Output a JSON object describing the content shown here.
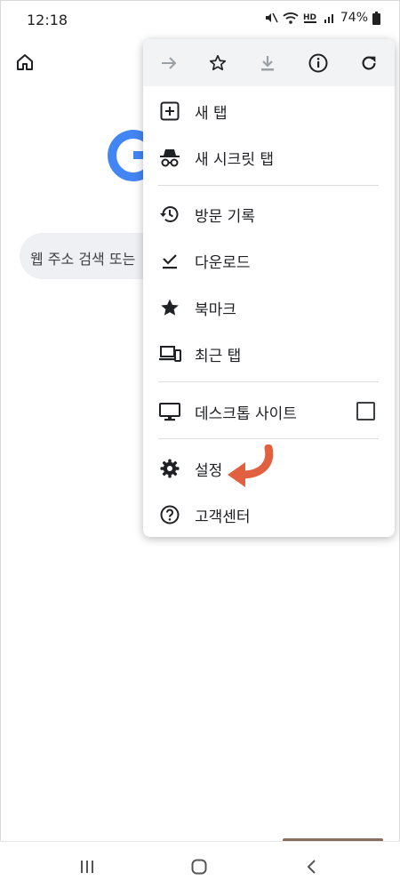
{
  "status_bar": {
    "time": "12:18",
    "battery": "74%",
    "icons": [
      "mute-icon",
      "wifi-icon",
      "hd-icon",
      "signal-icon",
      "battery-icon"
    ]
  },
  "page": {
    "search_placeholder": "웹 주소 검색 또는"
  },
  "menu": {
    "toolbar_icons": [
      "forward-icon",
      "bookmark-star-icon",
      "download-icon",
      "info-icon",
      "reload-icon"
    ],
    "items": [
      {
        "label": "새 탭",
        "icon": "new-tab-icon"
      },
      {
        "label": "새 시크릿 탭",
        "icon": "incognito-icon"
      },
      {
        "label": "방문 기록",
        "icon": "history-icon"
      },
      {
        "label": "다운로드",
        "icon": "downloads-icon"
      },
      {
        "label": "북마크",
        "icon": "bookmarks-icon"
      },
      {
        "label": "최근 탭",
        "icon": "recent-tabs-icon"
      },
      {
        "label": "데스크톱 사이트",
        "icon": "desktop-icon",
        "checked": false
      },
      {
        "label": "설정",
        "icon": "settings-icon"
      },
      {
        "label": "고객센터",
        "icon": "help-icon"
      }
    ]
  },
  "colors": {
    "annotation_arrow": "#e0603f",
    "google_blue": "#4285f4",
    "menu_toolbar_bg": "#f1f3f4"
  },
  "navbar": {
    "icons": [
      "recents-icon",
      "home-nav-icon",
      "back-icon"
    ]
  }
}
